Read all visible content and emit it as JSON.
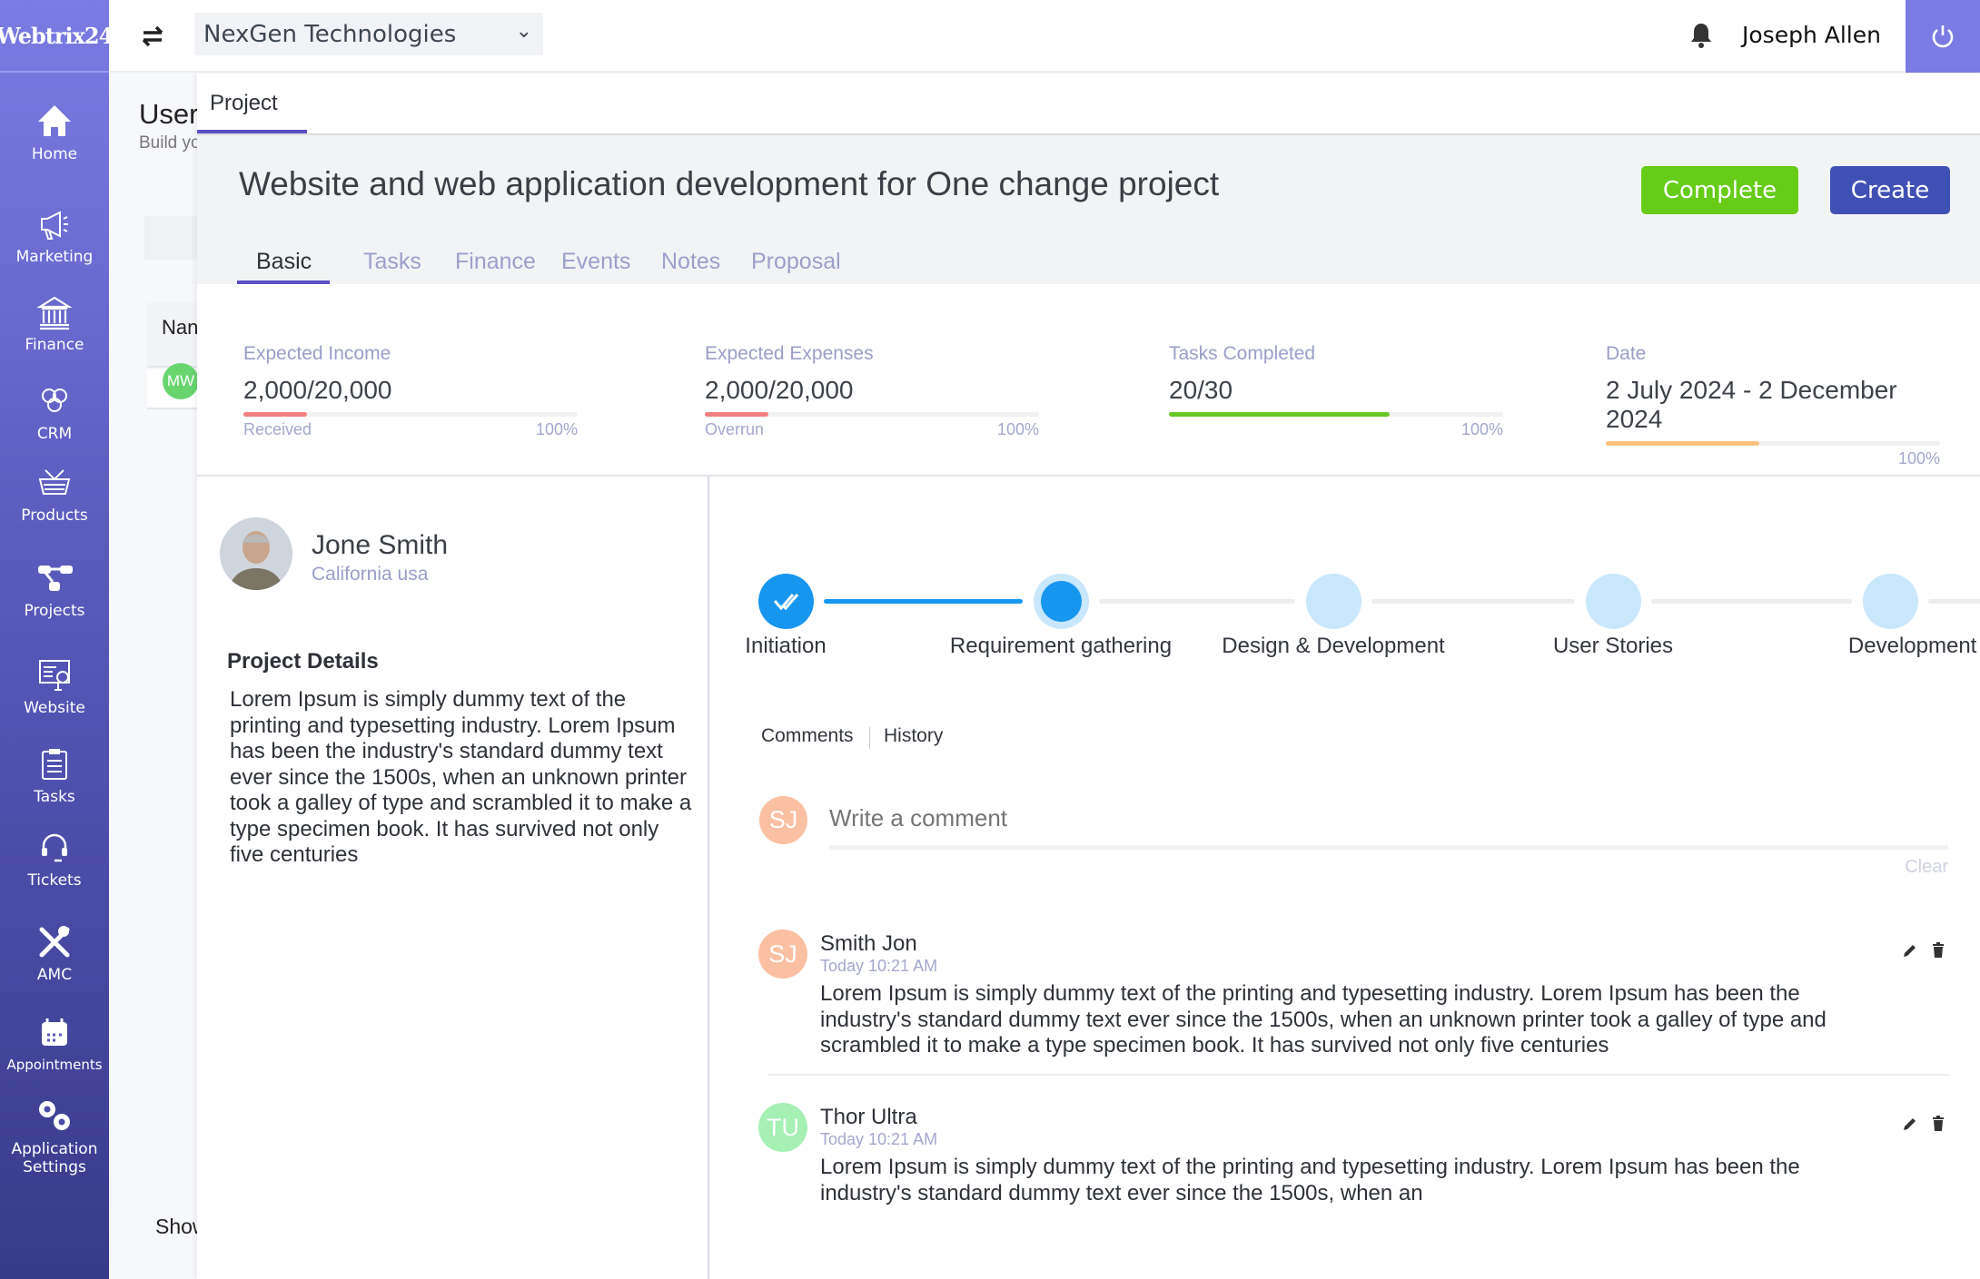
{
  "brand": {
    "logo_text": "Webtrix24",
    "accent": "#7b7be3"
  },
  "sidebar": {
    "items": [
      {
        "label": "Home",
        "icon": "home-icon"
      },
      {
        "label": "Marketing",
        "icon": "megaphone-icon"
      },
      {
        "label": "Finance",
        "icon": "bank-icon"
      },
      {
        "label": "CRM",
        "icon": "people-icon"
      },
      {
        "label": "Products",
        "icon": "basket-icon"
      },
      {
        "label": "Projects",
        "icon": "project-tree-icon"
      },
      {
        "label": "Website",
        "icon": "monitor-icon"
      },
      {
        "label": "Tasks",
        "icon": "clipboard-icon"
      },
      {
        "label": "Tickets",
        "icon": "headset-icon"
      },
      {
        "label": "AMC",
        "icon": "tools-icon"
      },
      {
        "label": "Appointments",
        "icon": "calendar-icon"
      },
      {
        "label": "Application",
        "label2": "Settings",
        "icon": "gears-icon"
      }
    ]
  },
  "header": {
    "company": "NexGen Technologies",
    "user": "Joseph Allen"
  },
  "background_page": {
    "title": "User",
    "subtitle": "Build yo",
    "table_header": "Nan",
    "avatar": "MW",
    "footer": "Show"
  },
  "modal": {
    "tab": "Project",
    "title": "Website and web application development for One change project",
    "complete_label": "Complete",
    "create_label": "Create",
    "complete_color": "#66cc18",
    "create_color": "#4051b5",
    "tabs": [
      "Basic",
      "Tasks",
      "Finance",
      "Events",
      "Notes",
      "Proposal"
    ],
    "active_tab": "Basic",
    "stats": [
      {
        "label": "Expected Income",
        "value": "2,000/20,000",
        "foot_left": "Received",
        "foot_right": "100%",
        "progress": 0.19,
        "color": "#f37f7f"
      },
      {
        "label": "Expected Expenses",
        "value": "2,000/20,000",
        "foot_left": "Overrun",
        "foot_right": "100%",
        "progress": 0.19,
        "color": "#f37f7f"
      },
      {
        "label": "Tasks Completed",
        "value": "20/30",
        "foot_left": "",
        "foot_right": "100%",
        "progress": 0.66,
        "color": "#67c825"
      },
      {
        "label": "Date",
        "value": "2 July 2024 - 2 December 2024",
        "foot_left": "",
        "foot_right": "100%",
        "progress": 0.46,
        "color": "#fdc27f"
      }
    ],
    "client": {
      "name": "Jone Smith",
      "location": "California usa"
    },
    "details_heading": "Project Details",
    "details_text": "Lorem Ipsum is simply dummy text of the printing and  typesetting industry. Lorem Ipsum has been the industry's standard dummy  text ever since the 1500s, when an unknown printer took a galley of  type and scrambled it to make a type specimen book. It has survived not  only five centuries",
    "stages": [
      {
        "label": "Initiation",
        "status": "done"
      },
      {
        "label": "Requirement gathering",
        "status": "current"
      },
      {
        "label": "Design & Development",
        "status": "pending"
      },
      {
        "label": "User Stories",
        "status": "pending"
      },
      {
        "label": "Development Phase",
        "status": "pending"
      }
    ],
    "comment_tabs": [
      "Comments",
      "History"
    ],
    "comment_input": {
      "avatar": "SJ",
      "placeholder": "Write a comment",
      "clear": "Clear"
    },
    "comments": [
      {
        "avatar": "SJ",
        "avatar_color": "#fbbfa2",
        "name": "Smith Jon",
        "time": "Today 10:21 AM",
        "text": "Lorem Ipsum is simply dummy text of the printing and  typesetting industry. Lorem Ipsum has been the industry's standard dummy  text ever since the 1500s, when an unknown printer took a galley of  type and scrambled it to make a type specimen book. It has survived not  only five centuries"
      },
      {
        "avatar": "TU",
        "avatar_color": "#a6f0b4",
        "name": "Thor Ultra",
        "time": "Today 10:21 AM",
        "text": "Lorem Ipsum is simply dummy text of the printing and  typesetting industry. Lorem Ipsum has been the industry's standard dummy  text ever since the 1500s, when an"
      }
    ]
  }
}
